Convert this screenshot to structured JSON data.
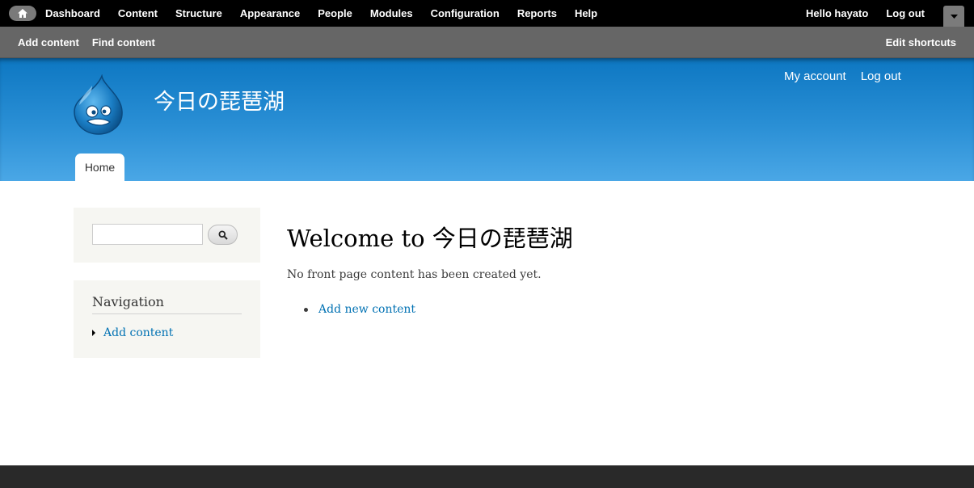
{
  "toolbar": {
    "home_icon": "home-icon",
    "menu": [
      "Dashboard",
      "Content",
      "Structure",
      "Appearance",
      "People",
      "Modules",
      "Configuration",
      "Reports",
      "Help"
    ],
    "hello_prefix": "Hello ",
    "username": "hayato",
    "logout": "Log out",
    "drawer_icon": "chevron-down-icon"
  },
  "shortcuts": {
    "links": [
      "Add content",
      "Find content"
    ],
    "edit": "Edit shortcuts"
  },
  "header": {
    "site_name": "今日の琵琶湖",
    "secondary_menu": [
      "My account",
      "Log out"
    ],
    "tab_home": "Home"
  },
  "sidebar": {
    "search_placeholder": "",
    "search_icon": "search-icon",
    "navigation_title": "Navigation",
    "navigation_items": [
      "Add content"
    ]
  },
  "main": {
    "title": "Welcome to 今日の琵琶湖",
    "empty_text": "No front page content has been created yet.",
    "links": [
      "Add new content"
    ]
  },
  "colors": {
    "toolbar_bg": "#000000",
    "shortcut_bg": "#666666",
    "header_top": "#0d77c2",
    "header_bottom": "#4aa7e6",
    "link": "#0071b3",
    "footer_bg": "#292929"
  }
}
